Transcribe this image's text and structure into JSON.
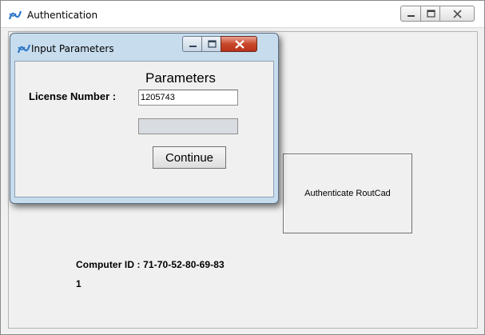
{
  "main_window": {
    "title": "Authentication",
    "icon": "app-logo-icon",
    "controls": [
      "minimize-icon",
      "maximize-icon",
      "close-icon"
    ]
  },
  "main_content": {
    "authenticate_button_label": "Authenticate RoutCad",
    "computer_id_text": "Computer ID : 71-70-52-80-69-83",
    "counter_text": "1"
  },
  "dialog": {
    "title": "Input Parameters",
    "icon": "app-logo-icon",
    "heading": "Parameters",
    "license_label": "License Number :",
    "license_value": "1205743",
    "disabled_field_value": "",
    "continue_label": "Continue"
  },
  "colors": {
    "dialog_frame": "#c7dced",
    "close_button": "#c9472a",
    "window_background": "#f0f0f0"
  }
}
